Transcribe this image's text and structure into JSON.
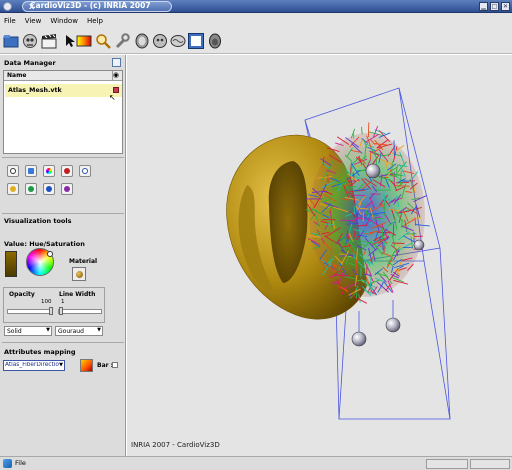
{
  "window": {
    "title": "CardioViz3D - (c) INRIA 2007",
    "title_x": "X",
    "buttons": [
      "▁",
      "□",
      "✕"
    ]
  },
  "menu": [
    "File",
    "View",
    "Window",
    "Help"
  ],
  "toolbar": {
    "icons": [
      "open-folder-icon",
      "skull-icon",
      "clapperboard-icon",
      "arrow-cursor-icon",
      "color-palette-icon",
      "magnifier-icon",
      "wrench-icon",
      "head-icon",
      "head-profile-icon",
      "brain-icon",
      "view-frame-icon",
      "head-mask-icon"
    ]
  },
  "data_manager": {
    "title": "Data Manager",
    "column_name": "Name",
    "column_visible": "◉",
    "rows": [
      {
        "name": "Atlas_Mesh.vtk"
      }
    ]
  },
  "tool_icons_row1": [
    "info-icon",
    "layers-icon",
    "color-wheel-icon",
    "heart-shield-icon",
    "loop-icon"
  ],
  "tool_icons_row2": [
    "heart-yellow-icon",
    "heart-green-icon",
    "heart-blue-icon",
    "heart-purple-icon"
  ],
  "visualization": {
    "title": "Visualization tools",
    "value_label": "Value: Hue/Saturation",
    "material_label": "Material",
    "opacity_label": "Opacity",
    "opacity_value": "100",
    "line_width_label": "Line Width",
    "line_width_value": "1",
    "opacity_fraction": 1.0,
    "rep_mode": "Solid",
    "shading_mode": "Gouraud"
  },
  "attributes": {
    "title": "Attributes mapping",
    "selected": "Atlas_FiberDirections",
    "bar_label": "Bar :"
  },
  "viewport": {
    "caption": "INRIA 2007 - CardioViz3D",
    "background": "#e4e4e4",
    "mesh_color": "#b08a10",
    "bbox_color": "#4a56e0"
  },
  "status": {
    "text": "File"
  }
}
